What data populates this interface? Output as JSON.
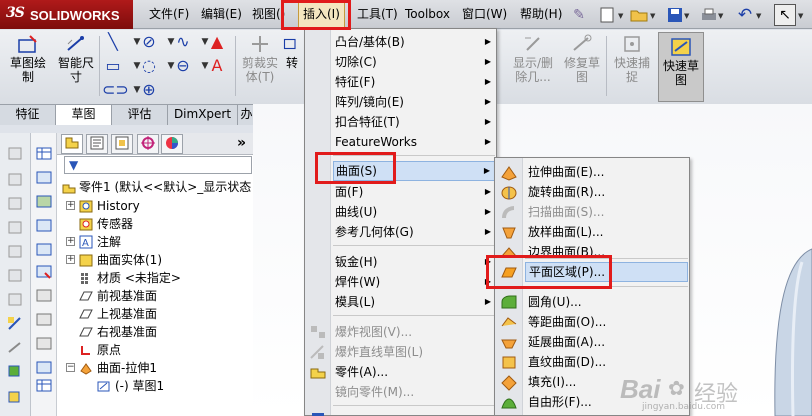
{
  "app": {
    "logo_mark": "3S",
    "logo_name": "SOLIDWORKS"
  },
  "menubar": {
    "items": [
      {
        "label": "文件(F)",
        "active": false
      },
      {
        "label": "编辑(E)",
        "active": false
      },
      {
        "label": "视图()",
        "active": false
      },
      {
        "label": "插入(I)",
        "active": true
      },
      {
        "label": "工具(T)",
        "active": false
      },
      {
        "label": "Toolbox",
        "active": false
      },
      {
        "label": "窗口(W)",
        "active": false
      },
      {
        "label": "帮助(H)",
        "active": false
      }
    ]
  },
  "commandmanager": {
    "tools": [
      {
        "label": "草图绘\n制"
      },
      {
        "label": "智能尺\n寸"
      },
      {
        "label": "剪裁实\n体(T)"
      },
      {
        "label": "转"
      },
      {
        "label": "显示/删\n除几..."
      },
      {
        "label": "修复草\n图"
      },
      {
        "label": "快速捕\n捉"
      },
      {
        "label": "快速草\n图"
      }
    ]
  },
  "tabs": [
    {
      "label": "特征",
      "active": false
    },
    {
      "label": "草图",
      "active": true
    },
    {
      "label": "评估",
      "active": false
    },
    {
      "label": "DimXpert",
      "active": false
    },
    {
      "label": "办公室产品",
      "active": false
    }
  ],
  "feature_tree": {
    "expand_label": "»",
    "rows": [
      {
        "label": "零件1  (默认<<默认>_显示状态"
      },
      {
        "label": "History"
      },
      {
        "label": "传感器"
      },
      {
        "label": "注解"
      },
      {
        "label": "曲面实体(1)"
      },
      {
        "label": "材质 <未指定>"
      },
      {
        "label": "前视基准面"
      },
      {
        "label": "上视基准面"
      },
      {
        "label": "右视基准面"
      },
      {
        "label": "原点"
      },
      {
        "label": "曲面-拉伸1"
      },
      {
        "label": "(-) 草图1"
      }
    ]
  },
  "insert_menu": {
    "items": [
      {
        "label": "凸台/基体(B)",
        "submenu": true,
        "disabled": false
      },
      {
        "label": "切除(C)",
        "submenu": true,
        "disabled": false
      },
      {
        "label": "特征(F)",
        "submenu": true,
        "disabled": false
      },
      {
        "label": "阵列/镜向(E)",
        "submenu": true,
        "disabled": false
      },
      {
        "label": "扣合特征(T)",
        "submenu": true,
        "disabled": false
      },
      {
        "label": "FeatureWorks",
        "submenu": true,
        "disabled": false
      },
      {
        "label": "曲面(S)",
        "submenu": true,
        "disabled": false,
        "highlighted": true
      },
      {
        "label": "面(F)",
        "submenu": true,
        "disabled": false
      },
      {
        "label": "曲线(U)",
        "submenu": true,
        "disabled": false
      },
      {
        "label": "参考几何体(G)",
        "submenu": true,
        "disabled": false
      },
      {
        "label": "钣金(H)",
        "submenu": true,
        "disabled": false
      },
      {
        "label": "焊件(W)",
        "submenu": true,
        "disabled": false
      },
      {
        "label": "模具(L)",
        "submenu": true,
        "disabled": false
      },
      {
        "label": "爆炸视图(V)...",
        "submenu": false,
        "disabled": true
      },
      {
        "label": "爆炸直线草图(L)",
        "submenu": false,
        "disabled": true
      },
      {
        "label": "零件(A)...",
        "submenu": false,
        "disabled": false
      },
      {
        "label": "镜向零件(M)...",
        "submenu": false,
        "disabled": true
      }
    ]
  },
  "surface_menu": {
    "items": [
      {
        "label": "拉伸曲面(E)...",
        "disabled": false
      },
      {
        "label": "旋转曲面(R)...",
        "disabled": false
      },
      {
        "label": "扫描曲面(S)...",
        "disabled": true
      },
      {
        "label": "放样曲面(L)...",
        "disabled": false
      },
      {
        "label": "边界曲面(B)...",
        "disabled": false
      },
      {
        "label": "平面区域(P)...",
        "disabled": false,
        "highlighted": true
      },
      {
        "label": "圆角(U)...",
        "disabled": false
      },
      {
        "label": "等距曲面(O)...",
        "disabled": false
      },
      {
        "label": "延展曲面(A)...",
        "disabled": false
      },
      {
        "label": "直纹曲面(D)...",
        "disabled": false
      },
      {
        "label": "填充(I)...",
        "disabled": false
      },
      {
        "label": "自由形(F)...",
        "disabled": false
      }
    ]
  },
  "watermark": {
    "brand": "Bai",
    "brand2": "经验",
    "url": "jingyan.baidu.com"
  },
  "colors": {
    "highlight_box": "#e11b1b",
    "menu_hover": "#cfe0f5",
    "logo_bg": "#9a1414"
  }
}
